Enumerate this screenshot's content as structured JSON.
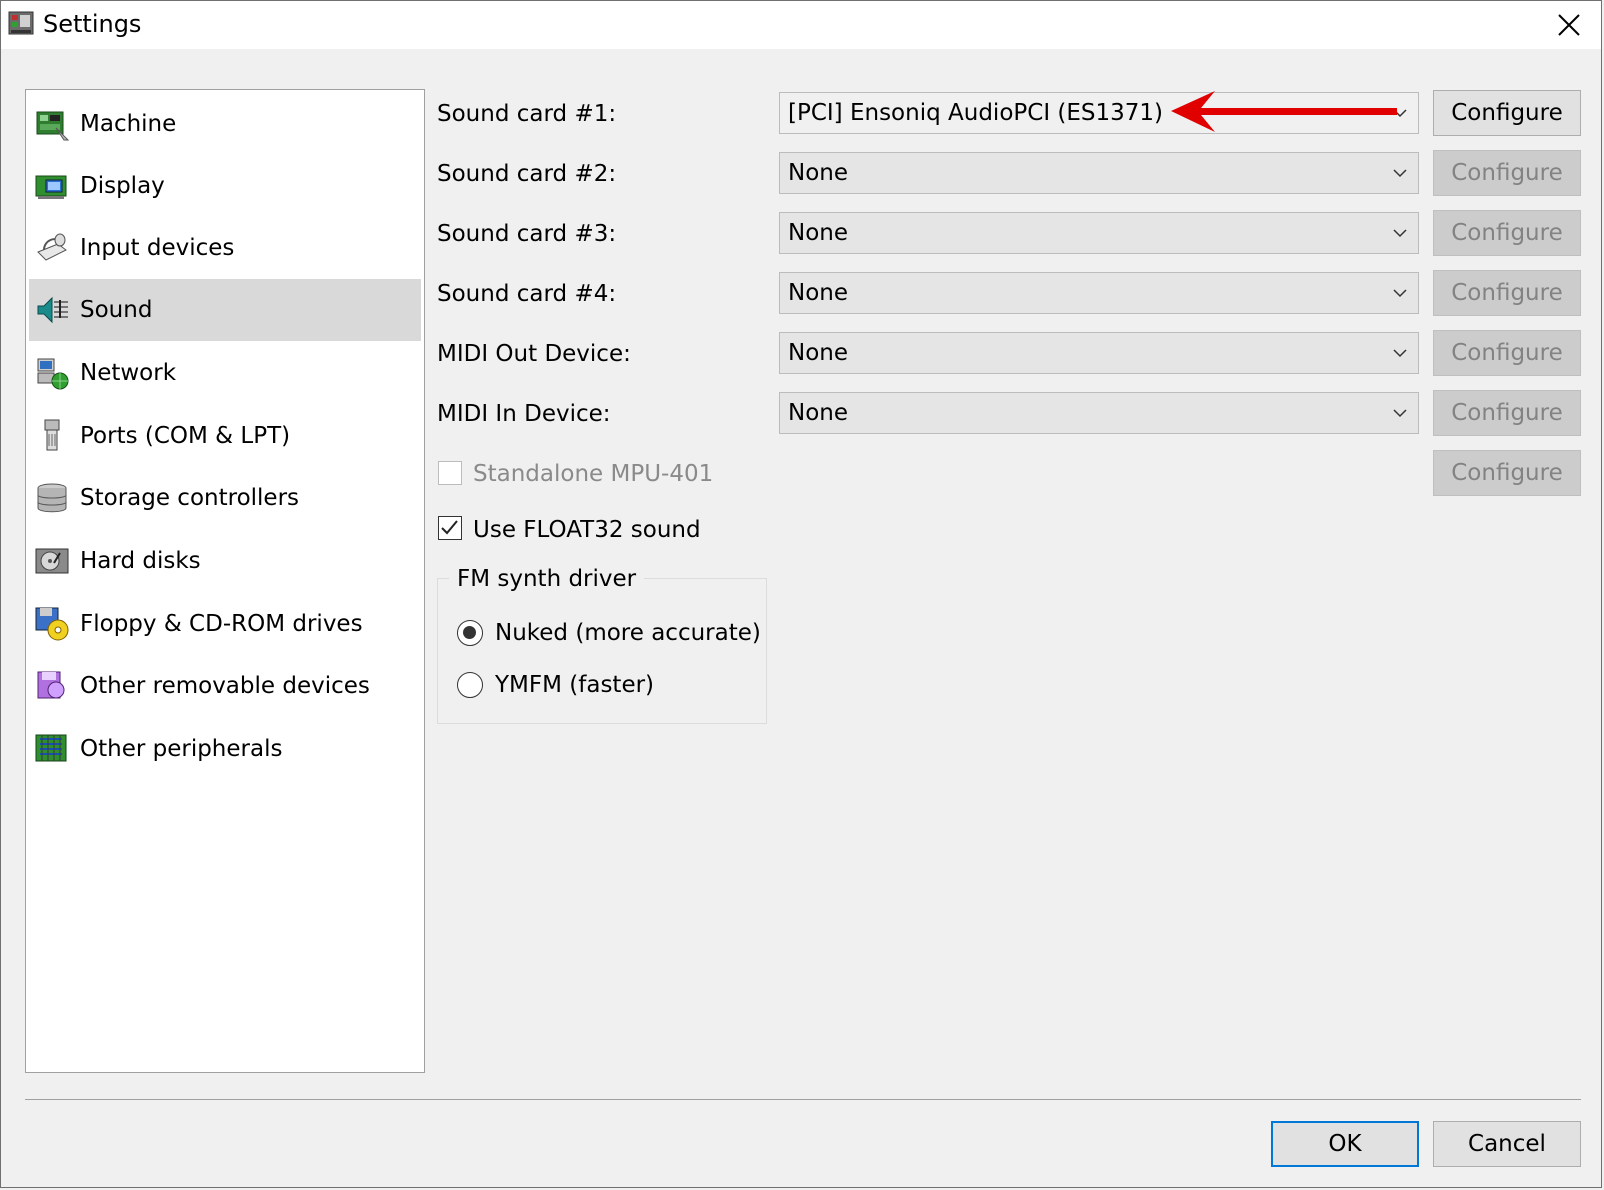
{
  "window": {
    "title": "Settings"
  },
  "sidebar": {
    "selected": "Sound",
    "items": [
      {
        "label": "Machine",
        "icon": "machine-icon"
      },
      {
        "label": "Display",
        "icon": "display-icon"
      },
      {
        "label": "Input devices",
        "icon": "input-devices-icon"
      },
      {
        "label": "Sound",
        "icon": "sound-icon"
      },
      {
        "label": "Network",
        "icon": "network-icon"
      },
      {
        "label": "Ports (COM & LPT)",
        "icon": "ports-icon"
      },
      {
        "label": "Storage controllers",
        "icon": "storage-controllers-icon"
      },
      {
        "label": "Hard disks",
        "icon": "hard-disks-icon"
      },
      {
        "label": "Floppy & CD-ROM drives",
        "icon": "floppy-cdrom-icon"
      },
      {
        "label": "Other removable devices",
        "icon": "removable-devices-icon"
      },
      {
        "label": "Other peripherals",
        "icon": "peripherals-icon"
      }
    ]
  },
  "sound": {
    "rows": [
      {
        "label": "Sound card #1:",
        "value": "[PCI] Ensoniq AudioPCI (ES1371)",
        "button": "Configure",
        "button_enabled": true
      },
      {
        "label": "Sound card #2:",
        "value": "None",
        "button": "Configure",
        "button_enabled": false
      },
      {
        "label": "Sound card #3:",
        "value": "None",
        "button": "Configure",
        "button_enabled": false
      },
      {
        "label": "Sound card #4:",
        "value": "None",
        "button": "Configure",
        "button_enabled": false
      },
      {
        "label": "MIDI Out Device:",
        "value": "None",
        "button": "Configure",
        "button_enabled": false
      },
      {
        "label": "MIDI In Device:",
        "value": "None",
        "button": "Configure",
        "button_enabled": false
      }
    ],
    "standalone_mpu": {
      "label": "Standalone MPU-401",
      "checked": false,
      "enabled": false,
      "button": "Configure"
    },
    "float32": {
      "label": "Use FLOAT32 sound",
      "checked": true
    },
    "fm_synth": {
      "title": "FM synth driver",
      "options": [
        {
          "label": "Nuked (more accurate)",
          "selected": true
        },
        {
          "label": "YMFM (faster)",
          "selected": false
        }
      ]
    }
  },
  "footer": {
    "ok_label": "OK",
    "cancel_label": "Cancel"
  },
  "annotation": {
    "arrow_color": "#e00000"
  }
}
